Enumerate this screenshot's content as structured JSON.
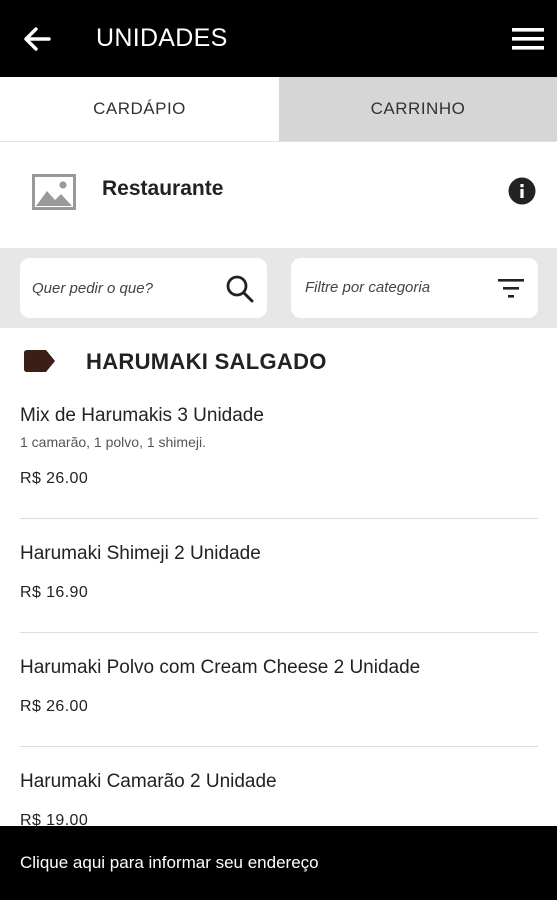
{
  "header": {
    "title": "UNIDADES",
    "back_icon": "arrow-left-icon",
    "menu_icon": "hamburger-menu-icon"
  },
  "tabs": [
    {
      "label": "CARDÁPIO",
      "active": true
    },
    {
      "label": "CARRINHO",
      "active": false
    }
  ],
  "restaurant": {
    "name": "Restaurante",
    "image_icon": "image-placeholder-icon",
    "info_icon": "info-icon"
  },
  "filters": {
    "search_placeholder": "Quer pedir o que?",
    "search_icon": "search-icon",
    "category_label": "Filtre por categoria",
    "category_icon": "filter-icon"
  },
  "section": {
    "title": "HARUMAKI SALGADO",
    "icon": "tag-icon"
  },
  "products": [
    {
      "name": "Mix de Harumakis 3 Unidade",
      "description": "1 camarão, 1 polvo, 1 shimeji.",
      "price": "R$ 26.00"
    },
    {
      "name": "Harumaki Shimeji 2 Unidade",
      "description": "",
      "price": "R$ 16.90"
    },
    {
      "name": "Harumaki Polvo com Cream Cheese 2 Unidade",
      "description": "",
      "price": "R$ 26.00"
    },
    {
      "name": "Harumaki Camarão 2 Unidade",
      "description": "",
      "price": "R$ 19.00"
    }
  ],
  "footer": {
    "address_prompt": "Clique aqui para informar seu endereço"
  },
  "colors": {
    "header_bg": "#000000",
    "inactive_tab_bg": "#d6d6d6",
    "filter_bar_bg": "#e7e7e7",
    "tag_color": "#3b1f17",
    "footer_bg": "#000000"
  }
}
